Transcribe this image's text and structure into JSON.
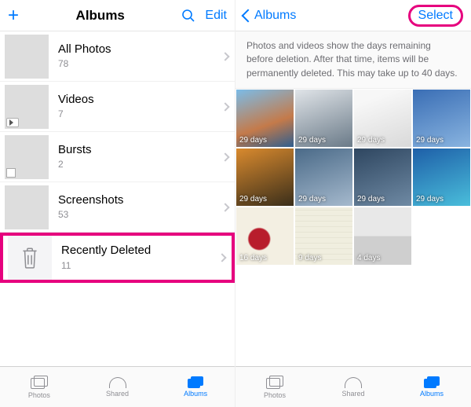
{
  "left": {
    "topbar": {
      "title": "Albums",
      "edit": "Edit"
    },
    "albums": [
      {
        "title": "All Photos",
        "count": "78"
      },
      {
        "title": "Videos",
        "count": "7"
      },
      {
        "title": "Bursts",
        "count": "2"
      },
      {
        "title": "Screenshots",
        "count": "53"
      },
      {
        "title": "Recently Deleted",
        "count": "11"
      }
    ],
    "tabs": {
      "photos": "Photos",
      "shared": "Shared",
      "albums": "Albums"
    }
  },
  "right": {
    "topbar": {
      "back": "Albums",
      "select": "Select"
    },
    "info": "Photos and videos show the days remaining before deletion. After that time, items will be permanently deleted. This may take up to 40 days.",
    "items": [
      {
        "days": "29 days"
      },
      {
        "days": "29 days"
      },
      {
        "days": "29 days"
      },
      {
        "days": "29 days"
      },
      {
        "days": "29 days"
      },
      {
        "days": "29 days"
      },
      {
        "days": "29 days"
      },
      {
        "days": "29 days"
      },
      {
        "days": "16 days"
      },
      {
        "days": "9 days"
      },
      {
        "days": "4 days"
      }
    ],
    "tabs": {
      "photos": "Photos",
      "shared": "Shared",
      "albums": "Albums"
    }
  }
}
